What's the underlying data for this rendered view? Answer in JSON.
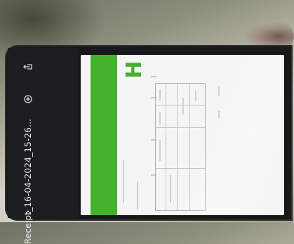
{
  "viewer": {
    "file_title": "Receipt_16-04-2024_15-26...",
    "share_icon": "share-icon",
    "open_icon": "open-in-icon",
    "back_icon": "back-arrow-icon"
  },
  "receipt": {
    "brand_color": "#45b12d",
    "logo_letter": "H"
  }
}
